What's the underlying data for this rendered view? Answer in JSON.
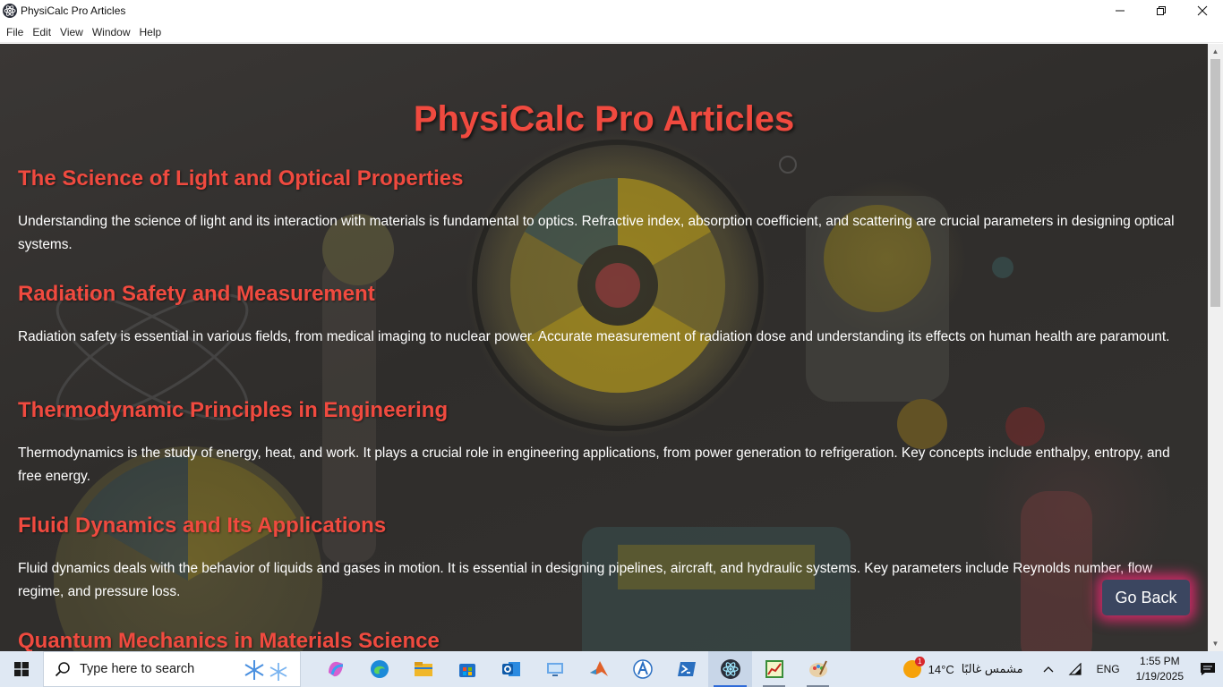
{
  "window": {
    "title": "PhysiCalc Pro Articles"
  },
  "menu": {
    "items": [
      "File",
      "Edit",
      "View",
      "Window",
      "Help"
    ]
  },
  "page": {
    "title": "PhysiCalc Pro Articles",
    "articles": [
      {
        "heading": "The Science of Light and Optical Properties",
        "body": "Understanding the science of light and its interaction with materials is fundamental to optics. Refractive index, absorption coefficient, and scattering are crucial parameters in designing optical systems."
      },
      {
        "heading": "Radiation Safety and Measurement",
        "body": "Radiation safety is essential in various fields, from medical imaging to nuclear power. Accurate measurement of radiation dose and understanding its effects on human health are paramount."
      },
      {
        "heading": "Thermodynamic Principles in Engineering",
        "body": "Thermodynamics is the study of energy, heat, and work. It plays a crucial role in engineering applications, from power generation to refrigeration. Key concepts include enthalpy, entropy, and free energy."
      },
      {
        "heading": "Fluid Dynamics and Its Applications",
        "body": "Fluid dynamics deals with the behavior of liquids and gases in motion. It is essential in designing pipelines, aircraft, and hydraulic systems. Key parameters include Reynolds number, flow regime, and pressure loss."
      },
      {
        "heading": "Quantum Mechanics in Materials Science",
        "body": ""
      }
    ],
    "go_back_label": "Go Back"
  },
  "taskbar": {
    "search_placeholder": "Type here to search",
    "weather_temp": "14°C",
    "weather_text": "مشمس غالبًا",
    "weather_badge": "1",
    "language": "ENG",
    "time": "1:55 PM",
    "date": "1/19/2025",
    "apps": [
      "copilot-icon",
      "edge-icon",
      "file-explorer-icon",
      "store-icon",
      "outlook-icon",
      "network-folder-icon",
      "matlab-icon",
      "arduino-icon",
      "powershell-icon",
      "electron-app-icon",
      "chart-app-icon",
      "paint-icon"
    ]
  },
  "colors": {
    "accent_heading": "#f04a3f",
    "button_bg": "#3b4660",
    "button_glow": "#ff2878"
  }
}
